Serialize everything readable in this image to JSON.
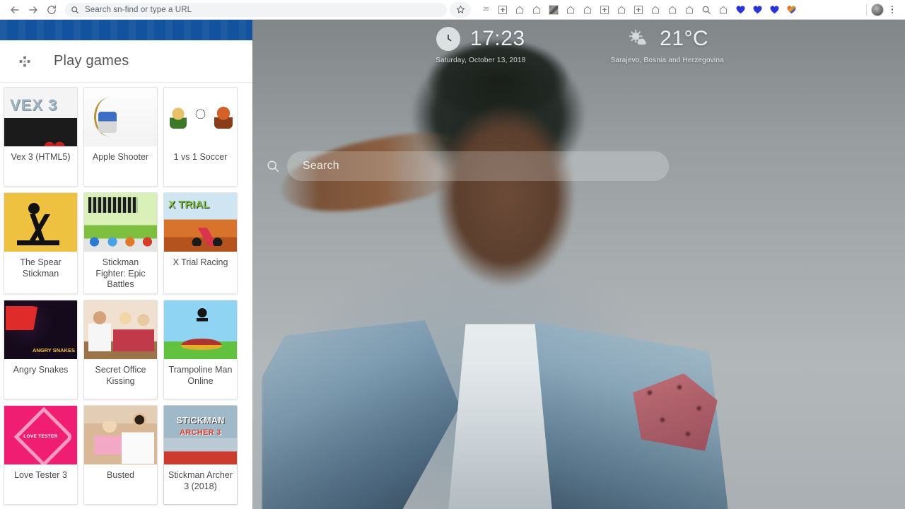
{
  "browser": {
    "back_label": "Back",
    "forward_label": "Forward",
    "reload_label": "Reload",
    "omnibox_text": "Search sn-find or type a URL",
    "extensions": [
      {
        "name": "js-extension-icon",
        "label": "JS"
      },
      {
        "name": "boxplus-extension-icon",
        "label": "+"
      },
      {
        "name": "home-extension-icon",
        "label": ""
      },
      {
        "name": "home-extension-icon",
        "label": ""
      },
      {
        "name": "photo-extension-icon",
        "label": ""
      },
      {
        "name": "home-extension-icon",
        "label": ""
      },
      {
        "name": "home-extension-icon",
        "label": ""
      },
      {
        "name": "boxplus-extension-icon",
        "label": "+"
      },
      {
        "name": "home-extension-icon",
        "label": ""
      },
      {
        "name": "boxplus-extension-icon",
        "label": "+"
      },
      {
        "name": "home-extension-icon",
        "label": ""
      },
      {
        "name": "home-extension-icon",
        "label": ""
      },
      {
        "name": "home-extension-icon",
        "label": ""
      },
      {
        "name": "search-extension-icon",
        "label": ""
      },
      {
        "name": "home-extension-icon",
        "label": ""
      },
      {
        "name": "heart-extension-icon",
        "label": ""
      },
      {
        "name": "heart-extension-icon",
        "label": ""
      },
      {
        "name": "heart-extension-icon",
        "label": ""
      },
      {
        "name": "heart-multicolor-extension-icon",
        "label": ""
      }
    ]
  },
  "newtab": {
    "clock": {
      "time": "17:23",
      "date": "Saturday, October 13, 2018"
    },
    "weather": {
      "temperature": "21°C",
      "location": "Sarajevo, Bosnia and Herzegovina"
    },
    "search": {
      "placeholder": "Search"
    }
  },
  "sidebar": {
    "title": "Play games",
    "games": [
      {
        "label": "Vex 3 (HTML5)",
        "art": "th-vex"
      },
      {
        "label": "Apple Shooter",
        "art": "th-apple"
      },
      {
        "label": "1 vs 1 Soccer",
        "art": "th-soccer"
      },
      {
        "label": "The Spear Stickman",
        "art": "th-spear"
      },
      {
        "label": "Stickman Fighter: Epic Battles",
        "art": "th-sfighter"
      },
      {
        "label": "X Trial Racing",
        "art": "th-xtrial"
      },
      {
        "label": "Angry Snakes",
        "art": "th-snakes"
      },
      {
        "label": "Secret Office Kissing",
        "art": "th-office"
      },
      {
        "label": "Trampoline Man Online",
        "art": "th-tramp"
      },
      {
        "label": "Love Tester 3",
        "art": "th-love"
      },
      {
        "label": "Busted",
        "art": "th-busted"
      },
      {
        "label": "Stickman Archer 3 (2018)",
        "art": "th-archer"
      }
    ]
  },
  "colors": {
    "sidebar_topbar": "#12529e",
    "omnibox_bg": "#f1f3f4",
    "heart_blue": "#2a33d8"
  }
}
